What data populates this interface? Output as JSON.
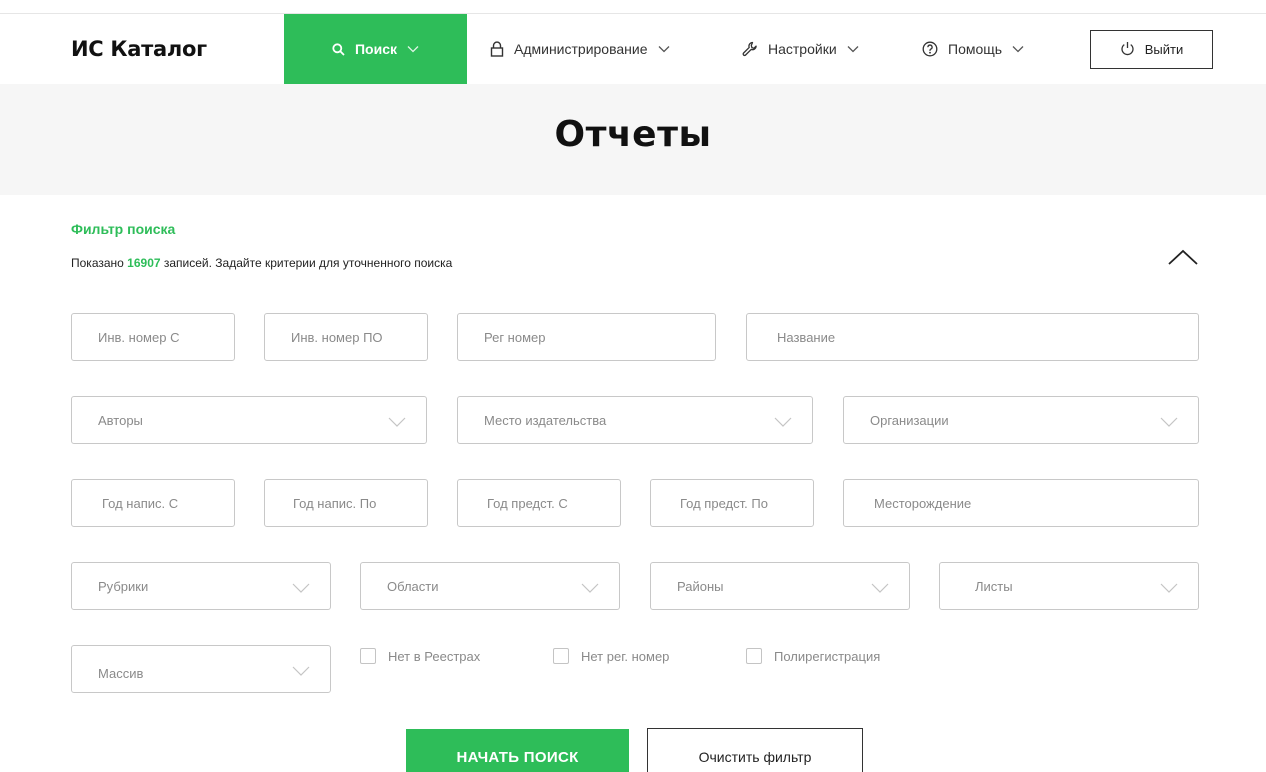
{
  "app": {
    "title": "ИС Каталог"
  },
  "nav": {
    "search": "Поиск",
    "admin": "Администрирование",
    "settings": "Настройки",
    "help": "Помощь",
    "logout": "Выйти"
  },
  "page": {
    "title": "Отчеты"
  },
  "filter": {
    "title": "Фильтр поиска",
    "summary_prefix": "Показано ",
    "record_count": "16907",
    "summary_suffix": " записей. Задайте критерии для уточненного поиска"
  },
  "fields": {
    "inv_from": "Инв. номер С",
    "inv_to": "Инв. номер ПО",
    "reg_number": "Рег номер",
    "name": "Название",
    "authors": "Авторы",
    "publish_place": "Место издательства",
    "organizations": "Организации",
    "year_written_from": "Год напис. С",
    "year_written_to": "Год напис. По",
    "year_submitted_from": "Год предст. С",
    "year_submitted_to": "Год предст. По",
    "deposit": "Месторождение",
    "rubrics": "Рубрики",
    "regions": "Области",
    "districts": "Районы",
    "sheets": "Листы",
    "massif": "Массив"
  },
  "checkboxes": {
    "no_registry": "Нет в Реестрах",
    "no_reg_number": "Нет рег. номер",
    "polyregistration": "Полирегистрация"
  },
  "actions": {
    "start_search": "НАЧАТЬ ПОИСК",
    "clear_filter": "Очистить фильтр"
  },
  "colors": {
    "accent": "#2ebd59",
    "border": "#c8c8c8",
    "placeholder": "#8a8a8a"
  }
}
